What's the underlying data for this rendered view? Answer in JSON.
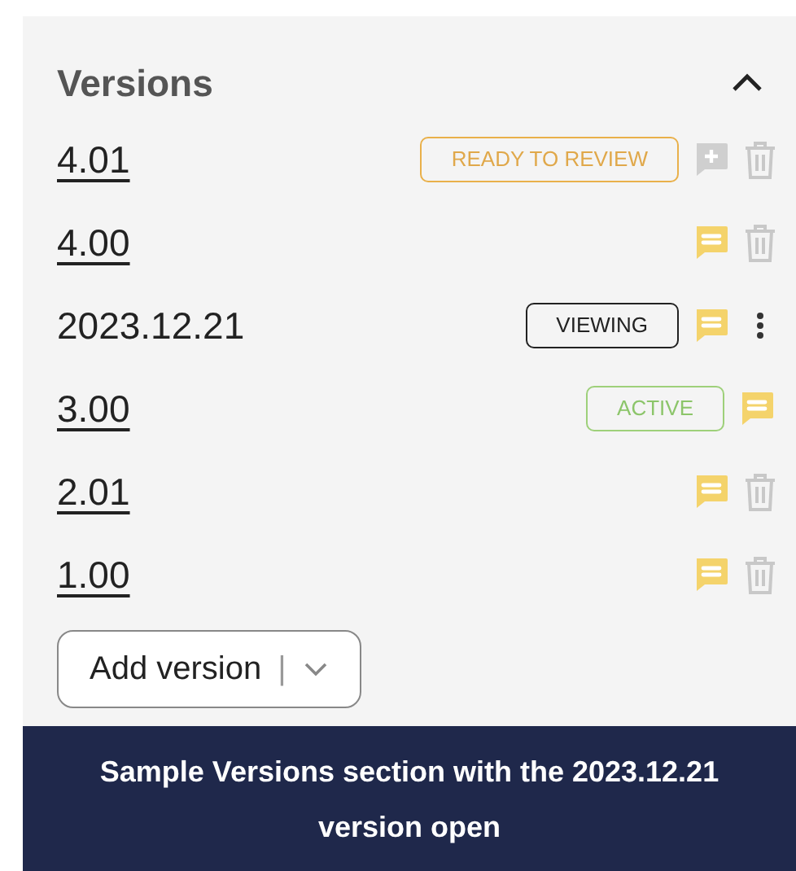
{
  "section": {
    "title": "Versions",
    "expanded": true
  },
  "versions": [
    {
      "label": "4.01",
      "link": true,
      "badge": {
        "kind": "review",
        "text": "READY TO REVIEW"
      },
      "comment": {
        "kind": "add"
      },
      "action": {
        "kind": "trash"
      }
    },
    {
      "label": "4.00",
      "link": true,
      "comment": {
        "kind": "note"
      },
      "action": {
        "kind": "trash"
      }
    },
    {
      "label": "2023.12.21",
      "link": false,
      "badge": {
        "kind": "viewing",
        "text": "VIEWING"
      },
      "comment": {
        "kind": "note"
      },
      "action": {
        "kind": "more"
      }
    },
    {
      "label": "3.00",
      "link": true,
      "badge": {
        "kind": "active",
        "text": "ACTIVE"
      },
      "comment": {
        "kind": "note"
      }
    },
    {
      "label": "2.01",
      "link": true,
      "comment": {
        "kind": "note"
      },
      "action": {
        "kind": "trash"
      }
    },
    {
      "label": "1.00",
      "link": true,
      "comment": {
        "kind": "note"
      },
      "action": {
        "kind": "trash"
      }
    }
  ],
  "add_button": {
    "label": "Add version",
    "separator": "|"
  },
  "caption": "Sample Versions section with the 2023.12.21 version open"
}
